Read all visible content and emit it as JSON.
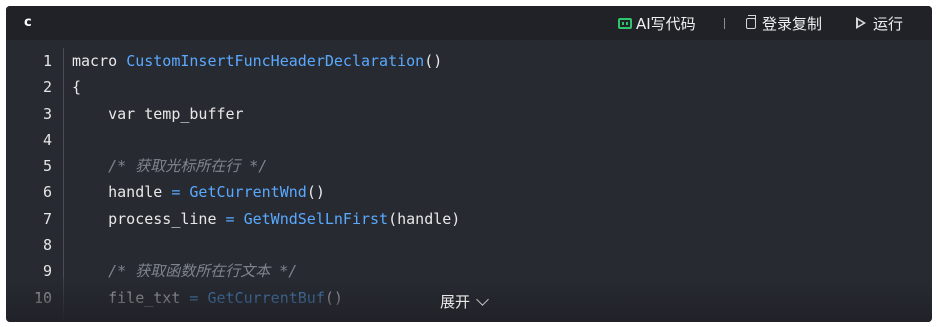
{
  "header": {
    "language": "c",
    "ai_label": "AI写代码",
    "copy_label": "登录复制",
    "run_label": "运行"
  },
  "code_lines": [
    {
      "n": "1",
      "parts": [
        {
          "t": "macro ",
          "c": ""
        },
        {
          "t": "CustomInsertFuncHeaderDeclaration",
          "c": "fn"
        },
        {
          "t": "()",
          "c": ""
        }
      ]
    },
    {
      "n": "2",
      "parts": [
        {
          "t": "{",
          "c": ""
        }
      ]
    },
    {
      "n": "3",
      "parts": [
        {
          "t": "    var temp_buffer",
          "c": ""
        }
      ]
    },
    {
      "n": "4",
      "parts": []
    },
    {
      "n": "5",
      "parts": [
        {
          "t": "    /* 获取光标所在行 */",
          "c": "cm"
        }
      ]
    },
    {
      "n": "6",
      "parts": [
        {
          "t": "    handle ",
          "c": ""
        },
        {
          "t": "=",
          "c": "op"
        },
        {
          "t": " ",
          "c": ""
        },
        {
          "t": "GetCurrentWnd",
          "c": "fn"
        },
        {
          "t": "()",
          "c": ""
        }
      ]
    },
    {
      "n": "7",
      "parts": [
        {
          "t": "    process_line ",
          "c": ""
        },
        {
          "t": "=",
          "c": "op"
        },
        {
          "t": " ",
          "c": ""
        },
        {
          "t": "GetWndSelLnFirst",
          "c": "fn"
        },
        {
          "t": "(handle)",
          "c": ""
        }
      ]
    },
    {
      "n": "8",
      "parts": []
    },
    {
      "n": "9",
      "parts": [
        {
          "t": "    /* 获取函数所在行文本 */",
          "c": "cm"
        }
      ]
    },
    {
      "n": "10",
      "parts": [
        {
          "t": "    file_txt ",
          "c": ""
        },
        {
          "t": "=",
          "c": "op"
        },
        {
          "t": " ",
          "c": ""
        },
        {
          "t": "GetCurrentBuf",
          "c": "fn"
        },
        {
          "t": "()",
          "c": ""
        }
      ]
    }
  ],
  "expand_label": "展开",
  "colors": {
    "background": "#272a31",
    "header": "#202228",
    "function": "#5aa9ff",
    "comment": "#7f848e",
    "ai_icon": "#2ec56b"
  }
}
